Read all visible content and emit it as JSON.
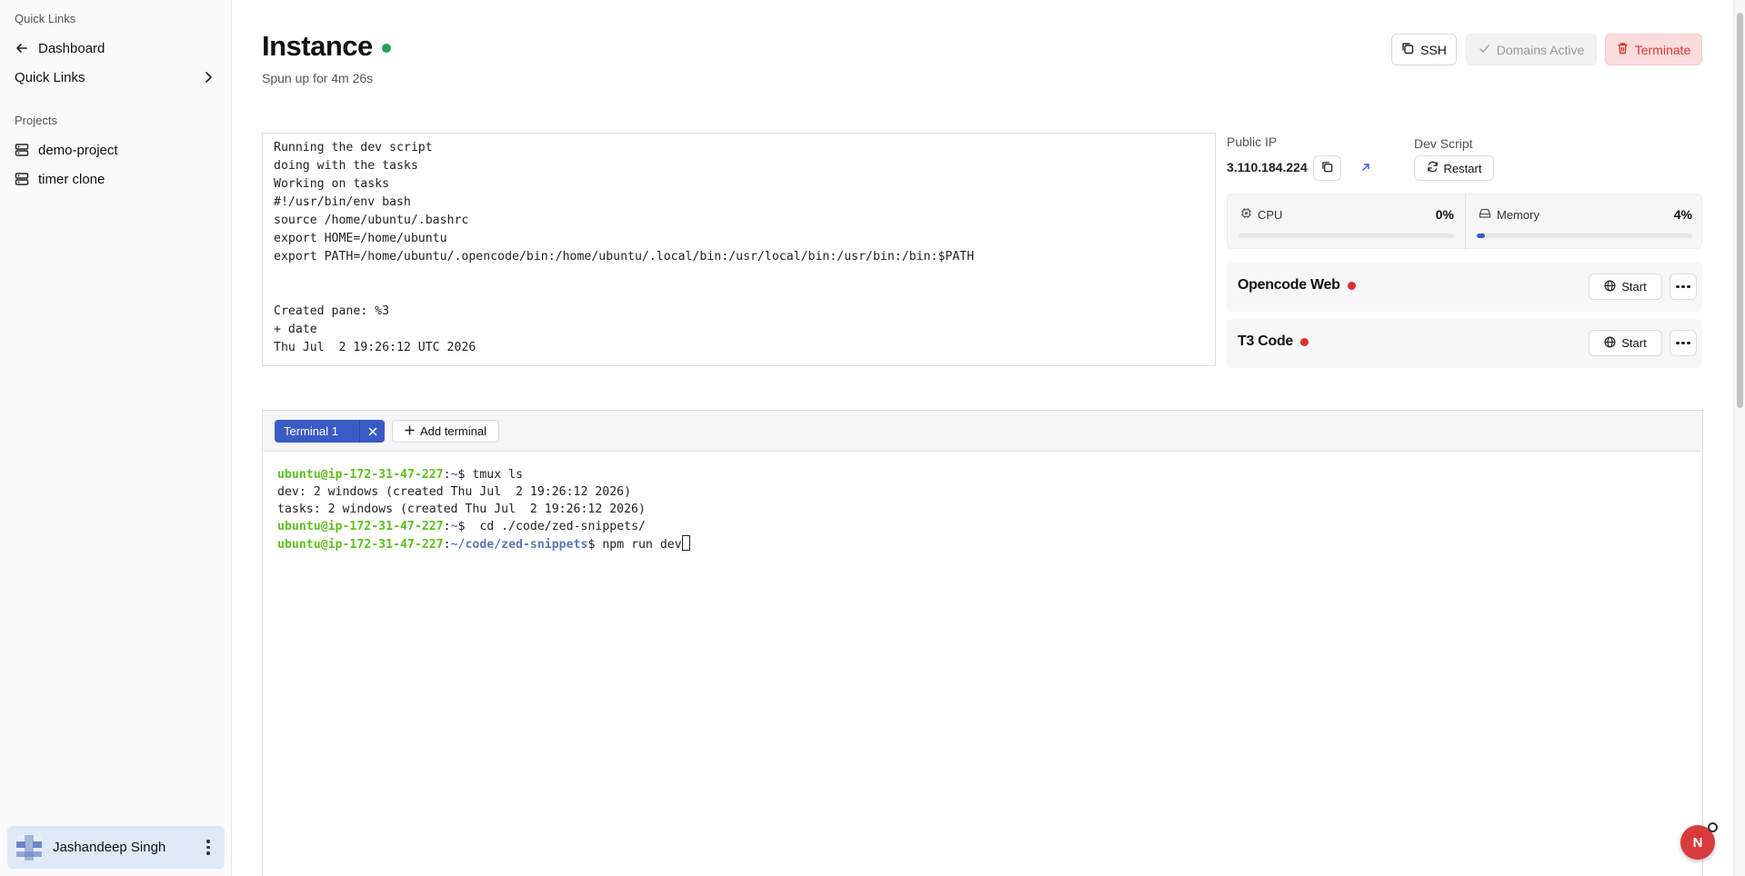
{
  "sidebar": {
    "section_quick_links": "Quick Links",
    "dashboard": "Dashboard",
    "quick_links": "Quick Links",
    "section_projects": "Projects",
    "projects": [
      "demo-project",
      "timer clone"
    ],
    "user_name": "Jashandeep Singh"
  },
  "header": {
    "title": "Instance",
    "subtitle": "Spun up for 4m 26s",
    "ssh_label": "SSH",
    "domains_label": "Domains Active",
    "terminate_label": "Terminate"
  },
  "colors": {
    "status_running": "#22a05a",
    "service_stopped": "#dc2f2f",
    "accent": "#3b5bc4",
    "danger": "#d93535"
  },
  "log": {
    "lines": [
      "Running the dev script",
      "doing with the tasks",
      "Working on tasks",
      "#!/usr/bin/env bash",
      "source /home/ubuntu/.bashrc",
      "export HOME=/home/ubuntu",
      "export PATH=/home/ubuntu/.opencode/bin:/home/ubuntu/.local/bin:/usr/local/bin:/usr/bin:/bin:$PATH",
      "",
      "",
      "Created pane: %3",
      "+ date",
      "Thu Jul  2 19:26:12 UTC 2026"
    ]
  },
  "instance": {
    "public_ip_label": "Public IP",
    "public_ip": "3.110.184.224",
    "dev_script_label": "Dev Script",
    "restart_label": "Restart"
  },
  "metrics": {
    "cpu_label": "CPU",
    "cpu_value": "0%",
    "cpu_fraction": 0.0,
    "memory_label": "Memory",
    "memory_value": "4%",
    "memory_fraction": 0.04
  },
  "services": [
    {
      "name": "Opencode Web",
      "start_label": "Start"
    },
    {
      "name": "T3 Code",
      "start_label": "Start"
    }
  ],
  "terminal": {
    "tab_label": "Terminal 1",
    "add_label": "Add terminal",
    "user_host": "ubuntu@ip-172-31-47-227",
    "lines": [
      {
        "path": "~",
        "cmd": "$ tmux ls"
      },
      {
        "output": "dev: 2 windows (created Thu Jul  2 19:26:12 2026)"
      },
      {
        "output": "tasks: 2 windows (created Thu Jul  2 19:26:12 2026)"
      },
      {
        "path": "~",
        "cmd": "$  cd ./code/zed-snippets/"
      },
      {
        "path": "~/code/zed-snippets",
        "cmd": "$ npm run dev"
      }
    ]
  },
  "fab_letter": "N"
}
